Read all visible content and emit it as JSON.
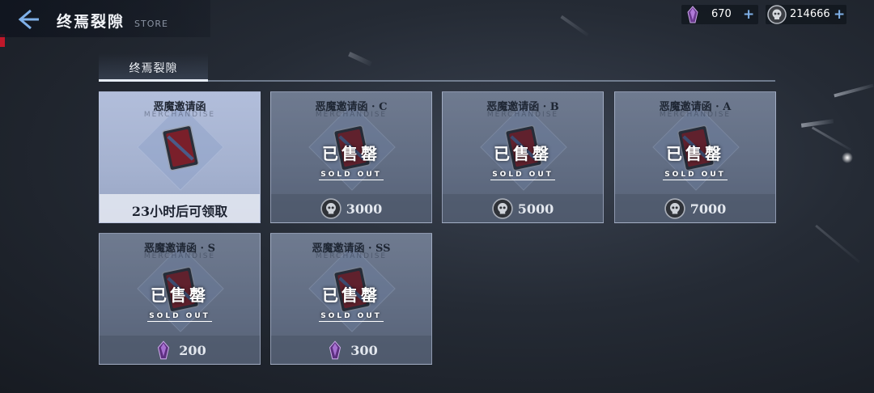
{
  "header": {
    "title": "终焉裂隙",
    "subtitle": "STORE",
    "back_icon": "back-arrow-icon"
  },
  "currency": {
    "gem": {
      "icon": "purple-crystal-icon",
      "value": "670",
      "plus": "+"
    },
    "coin": {
      "icon": "skull-coin-icon",
      "value": "214666",
      "plus": "+"
    }
  },
  "tabs": [
    {
      "label": "终焉裂隙",
      "active": true
    }
  ],
  "cards": [
    {
      "name": "恶魔邀请函",
      "merch": "MERCHANDISE",
      "status": "available",
      "footer": "23小时后可领取",
      "art": "mystery-card-icon",
      "letter": "?"
    },
    {
      "name": "恶魔邀请函 · C",
      "merch": "MERCHANDISE",
      "status": "sold",
      "sold_cn": "已售罄",
      "sold_en": "SOLD OUT",
      "price": "3000",
      "currency_icon": "skull-coin-icon",
      "art": "demon-card-c-icon",
      "letter": "C"
    },
    {
      "name": "恶魔邀请函 · B",
      "merch": "MERCHANDISE",
      "status": "sold",
      "sold_cn": "已售罄",
      "sold_en": "SOLD OUT",
      "price": "5000",
      "currency_icon": "skull-coin-icon",
      "art": "demon-card-b-icon",
      "letter": "B"
    },
    {
      "name": "恶魔邀请函 · A",
      "merch": "MERCHANDISE",
      "status": "sold",
      "sold_cn": "已售罄",
      "sold_en": "SOLD OUT",
      "price": "7000",
      "currency_icon": "skull-coin-icon",
      "art": "demon-card-a-icon",
      "letter": "A"
    },
    {
      "name": "恶魔邀请函 · S",
      "merch": "MERCHANDISE",
      "status": "sold",
      "sold_cn": "已售罄",
      "sold_en": "SOLD OUT",
      "price": "200",
      "currency_icon": "purple-crystal-icon",
      "art": "demon-card-s-icon",
      "letter": "S"
    },
    {
      "name": "恶魔邀请函 · SS",
      "merch": "MERCHANDISE",
      "status": "sold",
      "sold_cn": "已售罄",
      "sold_en": "SOLD OUT",
      "price": "300",
      "currency_icon": "purple-crystal-icon",
      "art": "demon-card-ss-icon",
      "letter": "SS"
    }
  ],
  "colors": {
    "accent": "#7fb0e8",
    "card_sold": "#7b87a0",
    "card_available": "#a4b1cf",
    "crystal": "#9a5cc0"
  }
}
